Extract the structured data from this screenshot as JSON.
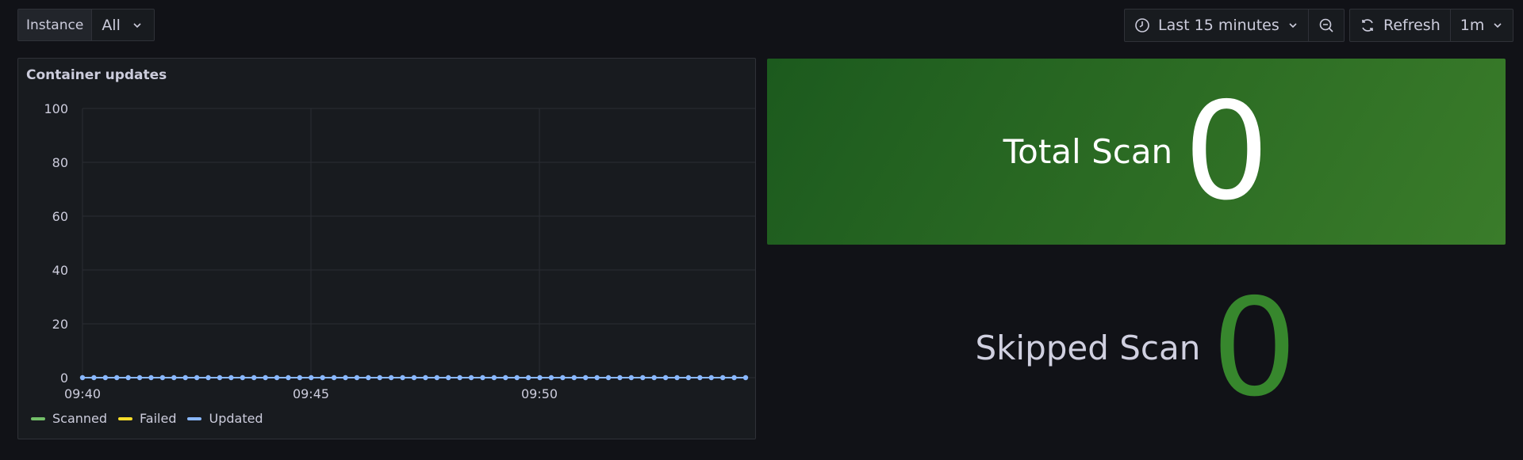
{
  "toolbar": {
    "variable_label": "Instance",
    "variable_value": "All",
    "time_range": "Last 15 minutes",
    "refresh_label": "Refresh",
    "refresh_interval": "1m"
  },
  "panels": {
    "graph_title": "Container updates",
    "total_scan": {
      "title": "Total Scan",
      "value": "0"
    },
    "skipped_scan": {
      "title": "Skipped Scan",
      "value": "0"
    }
  },
  "colors": {
    "scanned": "#73bf69",
    "failed": "#fade2a",
    "updated": "#8ab8ff",
    "total_bg": "#2d6d24",
    "skipped_value": "#37872d"
  },
  "chart_data": {
    "type": "line",
    "title": "Container updates",
    "ylim": [
      0,
      100
    ],
    "yticks": [
      "0",
      "20",
      "40",
      "60",
      "80",
      "100"
    ],
    "xticks": [
      "09:40",
      "09:45",
      "09:50"
    ],
    "series": [
      {
        "name": "Scanned",
        "value": 0
      },
      {
        "name": "Failed",
        "value": 0
      },
      {
        "name": "Updated",
        "value": 0,
        "points": 59
      }
    ],
    "legend": "bottom-left",
    "grid": true
  }
}
